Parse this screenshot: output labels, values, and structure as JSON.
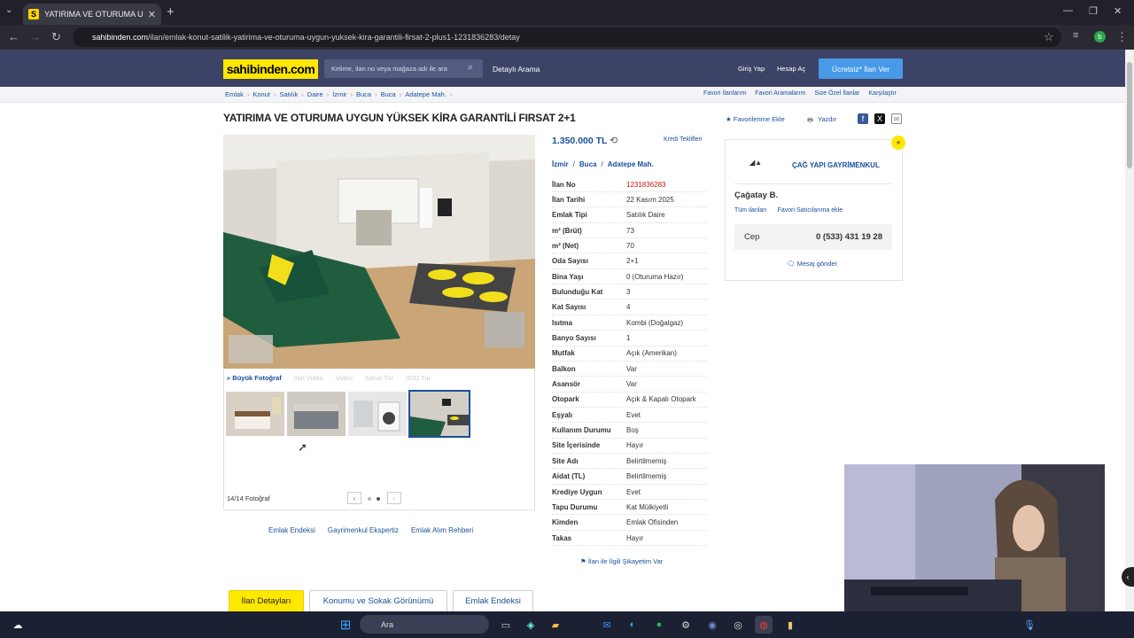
{
  "browser": {
    "tab_title": "YATIRIMA VE OTURUMA UYGUN",
    "tab_favicon": "S",
    "url_host": "sahibinden.com",
    "url_path": "/ilan/emlak-konut-satilik-yatirima-ve-oturuma-uygun-yuksek-kira-garantili-firsat-2-plus1-1231836283/detay",
    "profile_initial": "b"
  },
  "header": {
    "logo": "sahibinden.com",
    "search_placeholder": "Kelime, ilan no veya mağaza adı ile ara",
    "detayli": "Detaylı Arama",
    "login": "Giriş Yap",
    "register": "Hesap Aç",
    "cta": "Ücretsiz* İlan Ver"
  },
  "breadcrumb": [
    "Emlak",
    "Konut",
    "Satılık",
    "Daire",
    "İzmir",
    "Buca",
    "Buca",
    "Adatepe Mah."
  ],
  "breadcrumb_right": [
    "Favori İlanlarım",
    "Favori Aramalarım",
    "Size Özel İlanlar",
    "Karşılaştır"
  ],
  "listing": {
    "title": "YATIRIMA VE OTURUMA UYGUN YÜKSEK KİRA GARANTİLİ FIRSAT 2+1",
    "fav": "★ Favorilerime Ekle",
    "print": "Yazdır",
    "price": "1.350.000 TL",
    "kredi": "Kredi Teklifleri",
    "location": [
      "İzmir",
      "Buca",
      "Adatepe Mah."
    ],
    "details": [
      {
        "k": "İlan No",
        "v": "1231836283"
      },
      {
        "k": "İlan Tarihi",
        "v": "22 Kasım 2025"
      },
      {
        "k": "Emlak Tipi",
        "v": "Satılık Daire"
      },
      {
        "k": "m² (Brüt)",
        "v": "73"
      },
      {
        "k": "m² (Net)",
        "v": "70"
      },
      {
        "k": "Oda Sayısı",
        "v": "2+1"
      },
      {
        "k": "Bina Yaşı",
        "v": "0 (Oturuma Hazır)"
      },
      {
        "k": "Bulunduğu Kat",
        "v": "3"
      },
      {
        "k": "Kat Sayısı",
        "v": "4"
      },
      {
        "k": "Isıtma",
        "v": "Kombi (Doğalgaz)"
      },
      {
        "k": "Banyo Sayısı",
        "v": "1"
      },
      {
        "k": "Mutfak",
        "v": "Açık (Amerikan)"
      },
      {
        "k": "Balkon",
        "v": "Var"
      },
      {
        "k": "Asansör",
        "v": "Var"
      },
      {
        "k": "Otopark",
        "v": "Açık & Kapalı Otopark"
      },
      {
        "k": "Eşyalı",
        "v": "Evet"
      },
      {
        "k": "Kullanım Durumu",
        "v": "Boş"
      },
      {
        "k": "Site İçerisinde",
        "v": "Hayır"
      },
      {
        "k": "Site Adı",
        "v": "Belirtilmemiş"
      },
      {
        "k": "Aidat (TL)",
        "v": "Belirtilmemiş"
      },
      {
        "k": "Krediye Uygun",
        "v": "Evet"
      },
      {
        "k": "Tapu Durumu",
        "v": "Kat Mülkiyetli"
      },
      {
        "k": "Kimden",
        "v": "Emlak Ofisinden"
      },
      {
        "k": "Takas",
        "v": "Hayır"
      }
    ],
    "complaint": "İlan ile İlgili Şikayetim Var"
  },
  "gallery": {
    "tools": [
      "Büyük Fotoğraf",
      "İlan Video",
      "Video",
      "Sanal Tur",
      "3DD Tur"
    ],
    "counter": "14/14 Fotoğraf",
    "active_thumb_index": 3
  },
  "links_below": [
    "Emlak Endeksi",
    "Gayrimenkul Ekspertiz",
    "Emlak Alım Rehberi"
  ],
  "seller": {
    "office": "ÇAĞ YAPI GAYRİMENKUL",
    "person": "Çağatay B.",
    "links": [
      "Tüm ilanları",
      "Favori Satıcılarıma ekle"
    ],
    "phone_label": "Cep",
    "phone": "0 (533) 431 19 28",
    "message": "Mesaj gönder"
  },
  "bottom_tabs": [
    "İlan Detayları",
    "Konumu ve Sokak Görünümü",
    "Emlak Endeksi"
  ],
  "taskbar": {
    "search": "Ara"
  },
  "colors": {
    "brand_yellow": "#ffe800",
    "header_bg": "#3d4367",
    "link_blue": "#1a4f9c",
    "cta_blue": "#489ae9"
  }
}
